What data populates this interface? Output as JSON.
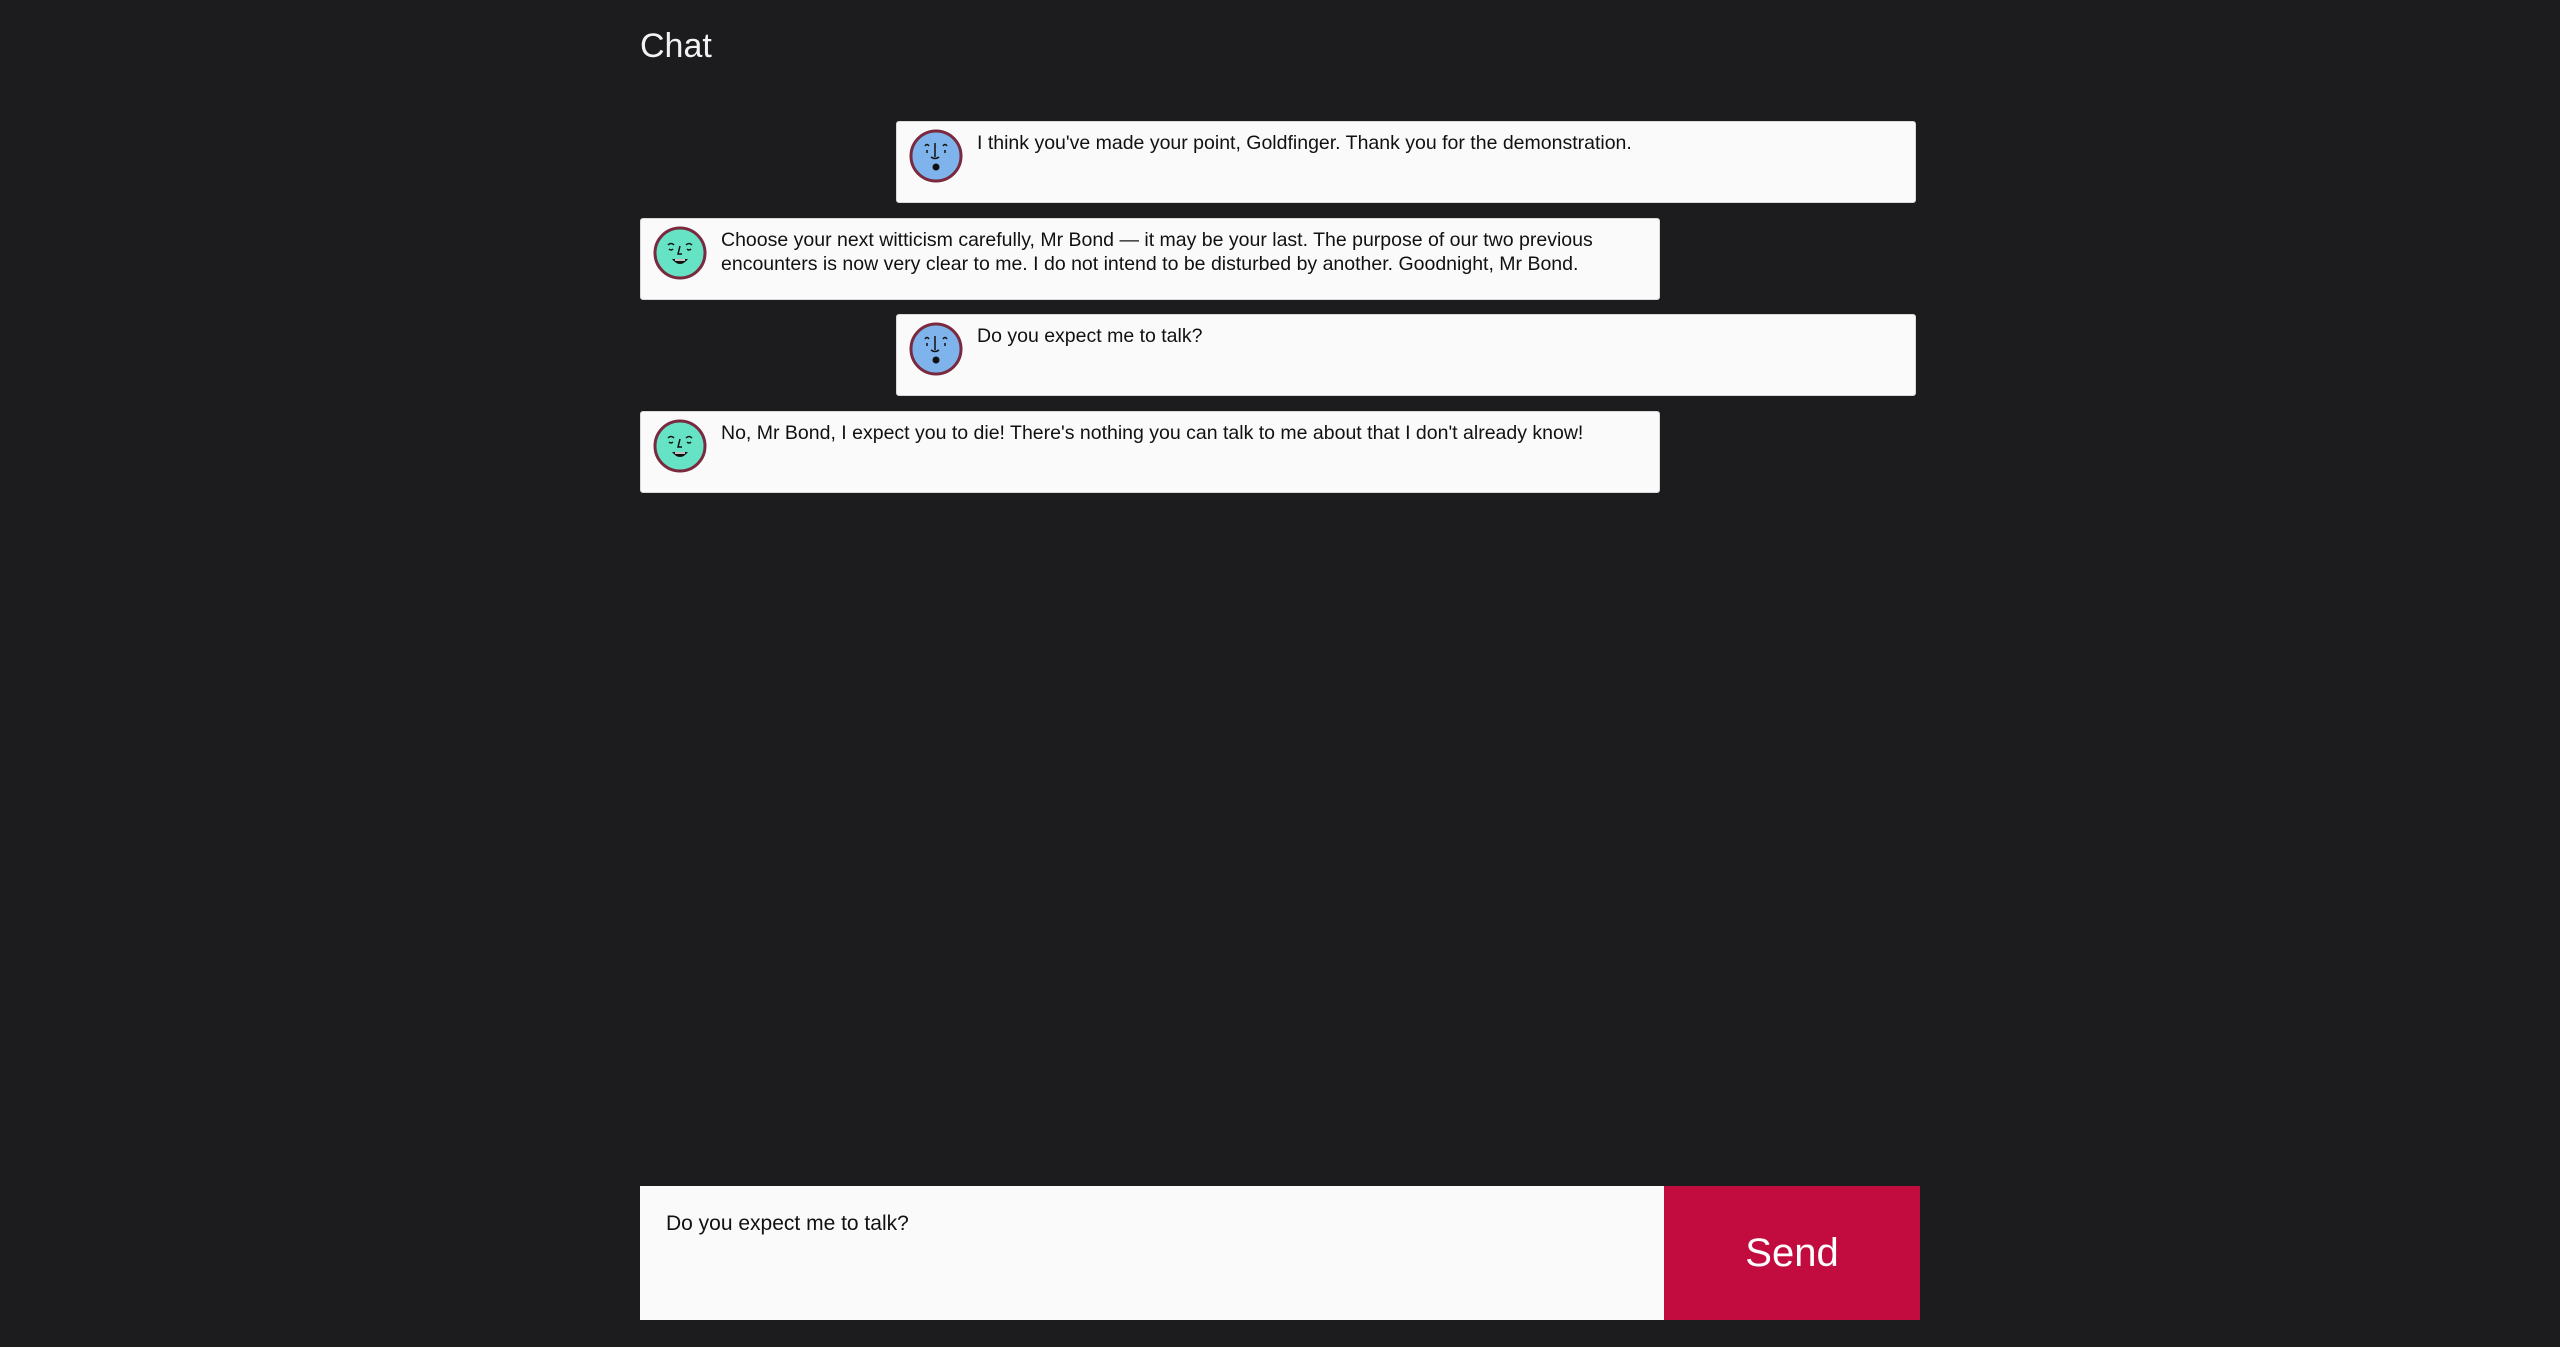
{
  "header": {
    "title": "Chat"
  },
  "colors": {
    "background": "#1c1c1e",
    "bubble": "#fafafa",
    "accent": "#c20c3f",
    "avatar_bond": "#7fb3ec",
    "avatar_goldfinger": "#66e3c4"
  },
  "messages": [
    {
      "side": "right",
      "avatar": "face-icon-bond",
      "text": "I think you've made your point, Goldfinger. Thank you for the demonstration."
    },
    {
      "side": "left",
      "avatar": "face-icon-goldfinger",
      "text": "Choose your next witticism carefully, Mr Bond — it may be your last. The purpose of our two previous encounters is now very clear to me. I do not intend to be disturbed by another. Goodnight, Mr Bond."
    },
    {
      "side": "right",
      "avatar": "face-icon-bond",
      "text": "Do you expect me to talk?"
    },
    {
      "side": "left",
      "avatar": "face-icon-goldfinger",
      "text": "No, Mr Bond, I expect you to die! There's nothing you can talk to me about that I don't already know!"
    }
  ],
  "composer": {
    "value": "Do you expect me to talk?",
    "send_label": "Send"
  }
}
